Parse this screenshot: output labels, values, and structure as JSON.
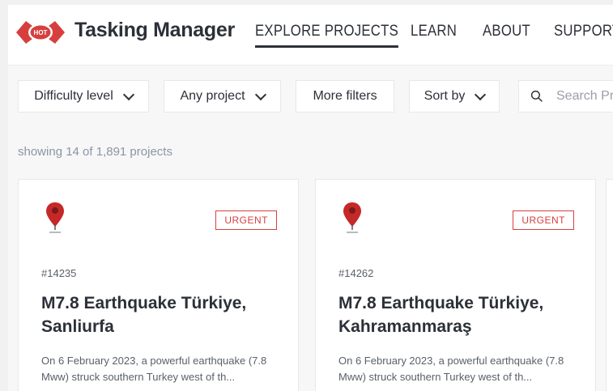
{
  "header": {
    "logo_text": "HOT",
    "app_title": "Tasking Manager",
    "nav": [
      {
        "label": "EXPLORE PROJECTS",
        "active": true
      },
      {
        "label": "LEARN",
        "active": false
      },
      {
        "label": "ABOUT",
        "active": false
      },
      {
        "label": "SUPPORT",
        "active": false
      }
    ]
  },
  "filters": {
    "difficulty": "Difficulty level",
    "project": "Any project",
    "more": "More filters",
    "sort": "Sort by",
    "search_placeholder": "Search Pr"
  },
  "listing": {
    "count_text": "showing 14 of 1,891 projects"
  },
  "cards": [
    {
      "badge": "URGENT",
      "id": "#14235",
      "title": "M7.8 Earthquake Türkiye, Sanliurfa",
      "description": "On 6 February 2023, a powerful earthquake (7.8 Mww) struck southern Turkey west of th..."
    },
    {
      "badge": "URGENT",
      "id": "#14262",
      "title": "M7.8 Earthquake Türkiye, Kahramanmaraş",
      "description": "On 6 February 2023, a powerful earthquake (7.8 Mww) struck southern Turkey west of th..."
    }
  ],
  "colors": {
    "brand_red": "#d73f3f",
    "text_dark": "#2c3038",
    "muted": "#8a96a6"
  },
  "icons": {
    "logo": "hot-logo-icon",
    "chevron": "chevron-down-icon",
    "search": "search-icon",
    "pin": "map-pin-icon"
  }
}
